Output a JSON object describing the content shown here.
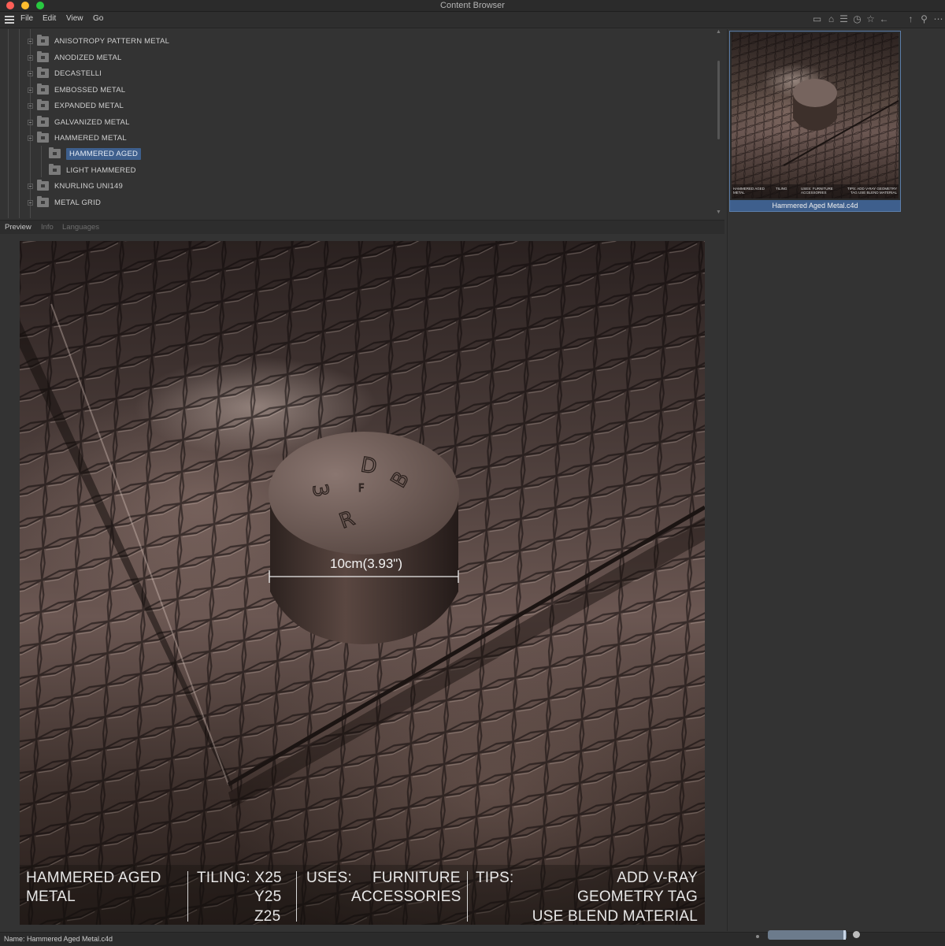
{
  "window": {
    "title": "Content Browser"
  },
  "menu": {
    "items": [
      "File",
      "Edit",
      "View",
      "Go"
    ]
  },
  "toolbar": {
    "icons": [
      "layout-icon",
      "home-icon",
      "settings-icon",
      "timer-icon",
      "star-icon",
      "back-arrow-icon",
      "up-arrow-icon",
      "search-icon",
      "more-icon"
    ]
  },
  "tree": {
    "items": [
      {
        "label": "ANISOTROPY PATTERN METAL"
      },
      {
        "label": "ANODIZED METAL"
      },
      {
        "label": "DECASTELLI"
      },
      {
        "label": "EMBOSSED METAL"
      },
      {
        "label": "EXPANDED METAL"
      },
      {
        "label": "GALVANIZED METAL"
      },
      {
        "label": "HAMMERED METAL"
      },
      {
        "label": "HAMMERED AGED"
      },
      {
        "label": "LIGHT HAMMERED"
      },
      {
        "label": "KNURLING UNI149"
      },
      {
        "label": "METAL GRID"
      }
    ]
  },
  "tabs": {
    "preview": "Preview",
    "info": "Info",
    "languages": "Languages"
  },
  "preview": {
    "measure": "10cm(3.93\")",
    "name_line1": "HAMMERED AGED",
    "name_line2": "METAL",
    "tiling_x": "TILING: X25",
    "tiling_y": "Y25",
    "tiling_z": "Z25",
    "uses_label": "USES:",
    "uses_1": "FURNITURE",
    "uses_2": "ACCESSORIES",
    "tips_label": "TIPS:",
    "tips_1": "ADD V-RAY",
    "tips_2": "GEOMETRY TAG",
    "tips_3": "USE BLEND MATERIAL",
    "cylinder_letters": [
      "D",
      "3",
      "F",
      "B",
      "R"
    ]
  },
  "thumbnail": {
    "caption": "Hammered Aged Metal.c4d",
    "small_name": "HAMMERED AGED METAL",
    "small_tiling": "TILING",
    "small_uses": "USES: FURNITURE ACCESSORIES",
    "small_tips": "TIPS: ADD V-RAY GEOMETRY TAG USE BLEND MATERIAL"
  },
  "status": {
    "name": "Name:  Hammered Aged Metal.c4d",
    "zoom": 0.98
  }
}
